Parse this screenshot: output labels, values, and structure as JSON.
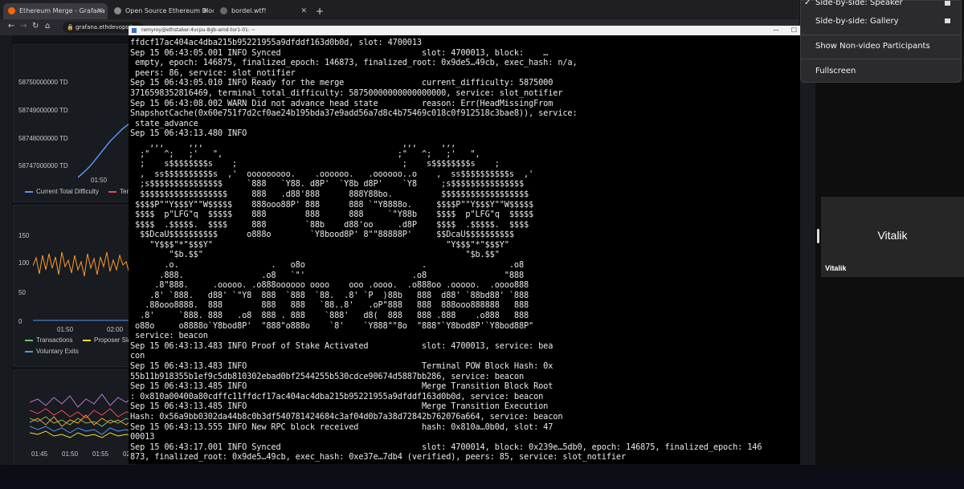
{
  "browser": {
    "tabs": [
      {
        "title": "Ethereum Merge - Grafana",
        "active": true
      },
      {
        "title": "Open Source Ethereum Blockchain Ex",
        "active": false
      },
      {
        "title": "bordel.wtf!",
        "active": false
      }
    ],
    "new_tab_label": "+",
    "url": "grafana.ethdevops.i"
  },
  "grafana": {
    "panel1": {
      "y_ticks": [
        "58750000000 TD",
        "58749000000 TD",
        "58748000000 TD",
        "58747000000 TD"
      ],
      "x_tick": "01:50",
      "legend": [
        {
          "label": "Current Total Difficulty",
          "color": "#5794f2"
        },
        {
          "label": "Ter",
          "color": "#f2495c"
        }
      ]
    },
    "panel2": {
      "y_ticks": [
        "150",
        "100",
        "50",
        "0"
      ],
      "x_ticks": [
        "01:50",
        "02:00"
      ],
      "legend": [
        {
          "label": "Transactions",
          "color": "#73bf69"
        },
        {
          "label": "Proposer Sla",
          "color": "#fade2a"
        },
        {
          "label": "Voluntary Exits",
          "color": "#5794f2"
        }
      ]
    },
    "panel3": {
      "x_ticks": [
        "01:45",
        "01:50",
        "01:55",
        "02"
      ]
    }
  },
  "terminal": {
    "title": "remyroy@ethstaker-4vcpu-8gb-amd-tor1-01: ~",
    "lines": [
      "ffdcf17ac404ac4dba215b95221955a9dfddf163d0b0d, slot: 4700013",
      "Sep 15 06:43:05.001 INFO Synced                             slot: 4700013, block:    …",
      " empty, epoch: 146875, finalized_epoch: 146873, finalized_root: 0x9de5…49cb, exec_hash: n/a,",
      " peers: 86, service: slot_notifier",
      "Sep 15 06:43:05.010 INFO Ready for the merge                current_difficulty: 5875000",
      "3716598352816469, terminal_total_difficulty: 58750000000000000000, service: slot_notifier",
      "Sep 15 06:43:08.002 WARN Did not advance head state         reason: Err(HeadMissingFrom",
      "SnapshotCache(0x60e751f7d2cf0ae24b195bda37e9add56a7d8c4b75469c018c0f912518c3bae8)), service:",
      " state_advance",
      "Sep 15 06:43:13.480 INFO",
      "    ,,,     ,,,                                         ,,,     ,,,",
      "  ;\"   ^;   ;'   \",                                    ;\"   ^;   ;'   \",",
      "  ;    s$$$$$$$$s    ;                                  ;    s$$$$$$$$s    ;",
      "  ,  ss$$$$$$$$$$s  ,'  ooooooooo.    .oooooo.   .oooooo..o    ,  ss$$$$$$$$$$s  ,'",
      "  ;s$$$$$$$$$$$$$$$     `888   `Y88. d8P'  `Y8b d8P'    `Y8     ;s$$$$$$$$$$$$$$$",
      "  $$$$$$$$$$$$$$$$$$     888   .d88'888      888Y88bo.          $$$$$$$$$$$$$$$$$$",
      " $$$$P\"\"Y$$$Y\"\"W$$$$$    888ooo88P' 888      888 `\"Y8888o.     $$$$P\"\"Y$$$Y\"\"W$$$$$",
      " $$$$  p\"LFG\"q  $$$$$    888        888      888     `\"Y88b    $$$$  p\"LFG\"q  $$$$$",
      " $$$$  .$$$$$.  $$$$     888        `88b    d88'oo     .d8P    $$$$  .$$$$$.  $$$$",
      "  $$DcaU$$$$$$$$$$      o888o        `Y8bood8P' 8\"\"88888P'     $$DcaU$$$$$$$$$$",
      "    \"Y$$$\"*\"$$$Y\"                                                \"Y$$$\"*\"$$$Y\"",
      "        \"$b.$$\"                                                      \"$b.$$\"",
      "       .o.                   .   o8o                        .                 .o8",
      "      .888.                .o8   `\"'                      .o8                \"888",
      "     .8\"888.     .ooooo. .o888oooooo oooo    ooo .oooo.  .o888oo .ooooo.  .oooo888",
      "    .8' `888.   d88' `\"Y8  888  `888  `88.  .8' `P  )88b   888  d88' `88bd88' `888",
      "   .88ooo8888.  888        888   888   `88..8'   .oP\"888   888  888ooo888888   888",
      "  .8'     `888. 888   .o8  888 . 888    `888'   d8(  888   888 .888    .o888   888",
      " o88o     o8888o`Y8bod8P'  \"888\"o888o    `8'    `Y888\"\"8o  \"888\"`Y8bod8P'`Y8bod88P\"",
      " service: beacon",
      "Sep 15 06:43:13.483 INFO Proof of Stake Activated           slot: 4700013, service: bea",
      "con",
      "Sep 15 06:43:13.483 INFO                                    Terminal POW Block Hash: 0x",
      "55b11b918355b1ef9c5db810302ebad0bf2544255b530cdce90674d5887bb286, service: beacon",
      "Sep 15 06:43:13.485 INFO                                    Merge Transition Block Root",
      ": 0x810a00400a80cdffc11ffdcf17ac404ac4dba215b95221955a9dfddf163d0b0d, service: beacon",
      "Sep 15 06:43:13.485 INFO                                    Merge Transition Execution",
      "Hash: 0x56a9bb0302da44b8c0b3df540781424684c3af04d0b7a38d72842b762076a664, service: beacon",
      "Sep 15 06:43:13.555 INFO New RPC block received             hash: 0x810a…0b0d, slot: 47",
      "00013",
      "Sep 15 06:43:17.001 INFO Synced                             slot: 4700014, block: 0x239e…5db0, epoch: 146875, finalized_epoch: 146",
      "873, finalized_root: 0x9de5…49cb, exec_hash: 0xe37e…7db4 (verified), peers: 85, service: slot_notifier"
    ]
  },
  "zoom": {
    "menu": {
      "items": [
        {
          "label": "Side-by-side: Speaker",
          "checked": true
        },
        {
          "label": "Side-by-side: Gallery",
          "checked": false
        },
        {
          "label": "Show Non-video Participants",
          "checked": false
        },
        {
          "label": "Fullscreen",
          "checked": false
        }
      ],
      "check_glyph": "✓"
    },
    "participant": {
      "name": "Vitalik",
      "label": "Vitalik"
    }
  }
}
